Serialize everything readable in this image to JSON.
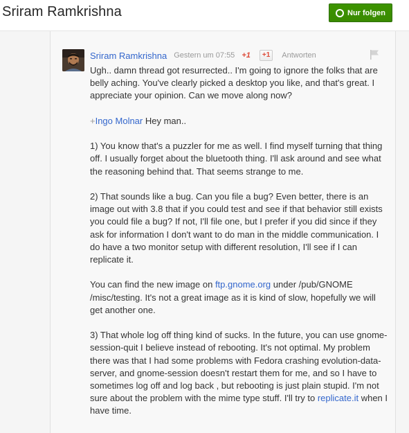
{
  "header": {
    "title": "Sriram Ramkrishna",
    "follow_button_label": "Nur folgen"
  },
  "comment": {
    "author": "Sriram Ramkrishna",
    "timestamp": "Gestern um 07:55",
    "plusone_count": "+1",
    "plusone_button_label": "+1",
    "reply_label": "Antworten",
    "p1": "Ugh.. damn thread got resurrected.. I'm going to ignore the folks that are belly aching.  You've clearly picked a desktop you like, and that's great.  I appreciate your opinion.  Can we move along now?",
    "p2_plus": "+",
    "p2_mention": "Ingo Molnar",
    "p2_rest": " Hey man..",
    "p3": "1) You know that's a puzzler for me as well.  I find myself turning that thing off.  I usually forget about the bluetooth thing.  I'll ask around and see what the reasoning behind that.  That seems strange to me.",
    "p4": "2)  That sounds like a bug.  Can you file a bug?  Even better, there is an image out with 3.8 that if you could test and see if that behavior still exists you could file a bug?  If not, I'll file one, but I prefer if you did since if they ask for information I don't want to do man in the middle communication.  I do have a two monitor setup with different resolution, I'll see if I can replicate it.",
    "p5_a": "You can find the new image on ",
    "p5_link": "ftp.gnome.org",
    "p5_b": " under /pub/GNOME /misc/testing.  It's not a great image as it is kind of slow, hopefully we will get another one.",
    "p6_a": "3)  That whole log off thing kind of sucks.  In the future, you can use gnome-session-quit I believe instead of rebooting.  It's not optimal.  My problem there was that I had some problems with Fedora crashing evolution-data-server, and gnome-session doesn't restart them for me, and so I have to sometimes log off and log back , but rebooting is just plain stupid.  I'm not sure about the problem with the mime type stuff.  I'll try to ",
    "p6_link": "replicate.it",
    "p6_b": " when I have time."
  },
  "colors": {
    "link": "#3366cc",
    "follow_green": "#3d9400",
    "plusone_red": "#dd4b39"
  },
  "icons": [
    "circle-icon",
    "flag-icon"
  ]
}
